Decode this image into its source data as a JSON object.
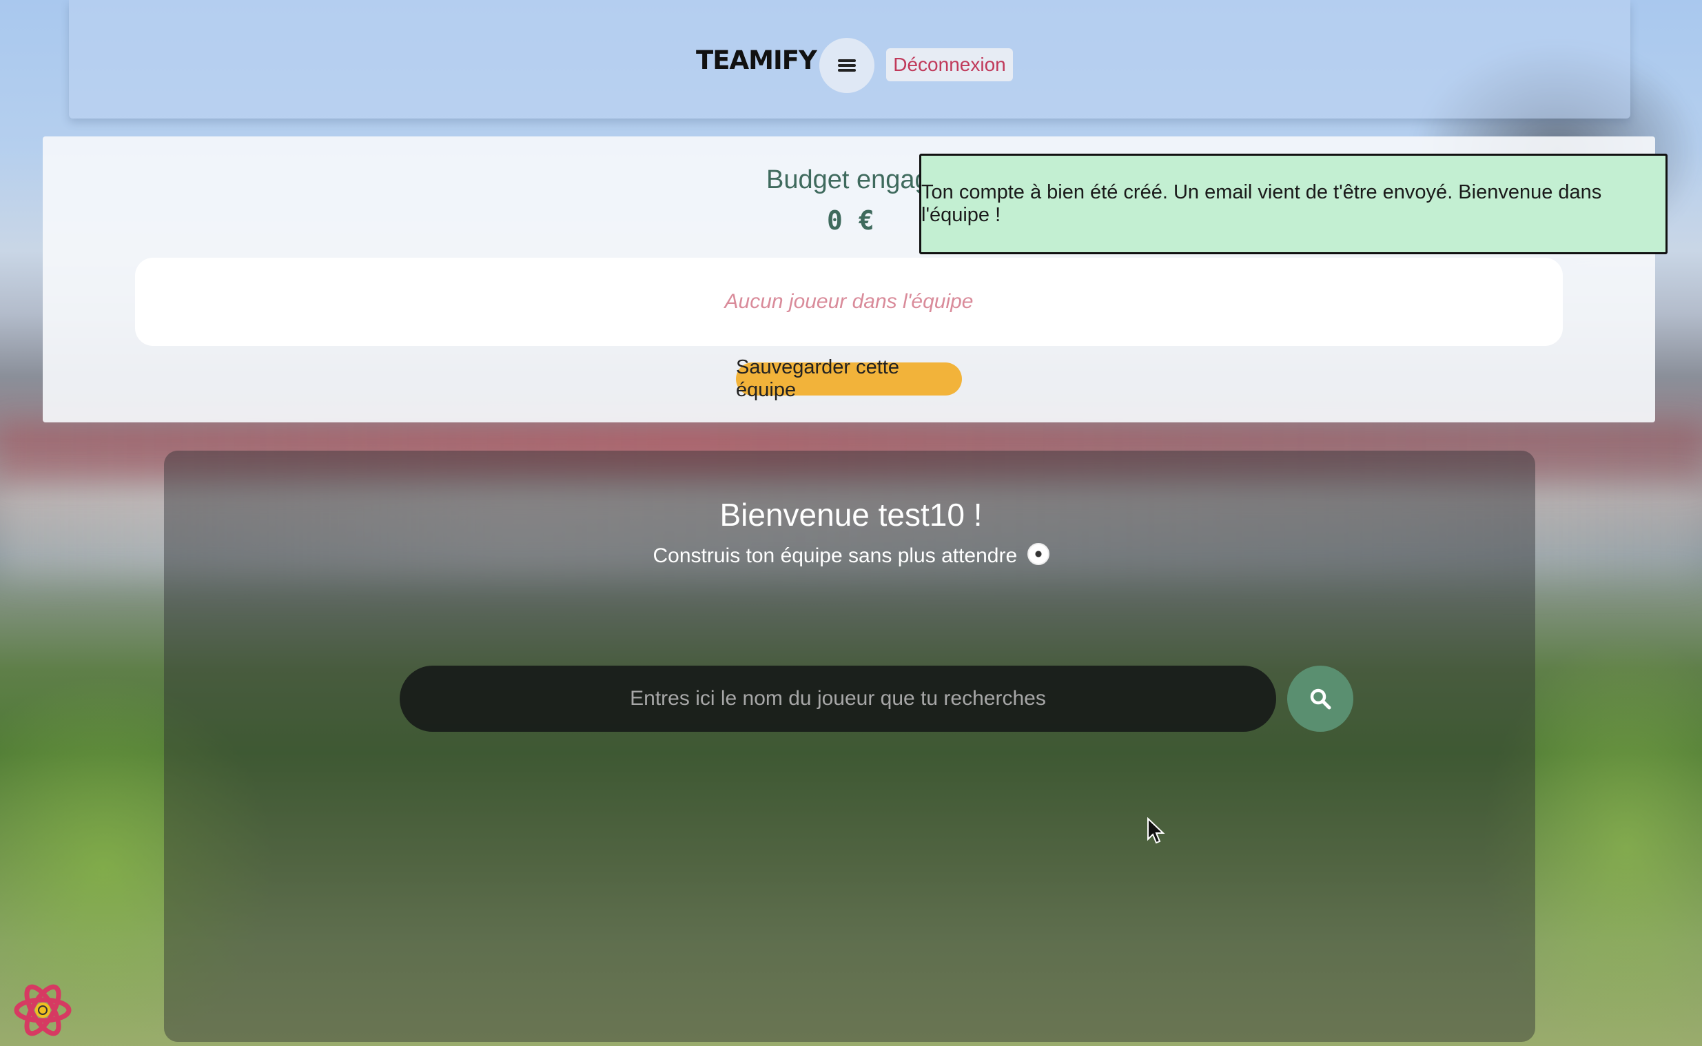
{
  "navbar": {
    "brand": "TEAMIFY",
    "menu_icon": "hamburger-menu-icon",
    "logout_label": "Déconnexion"
  },
  "team": {
    "budget_label": "Budget engagé",
    "budget_value": "0 €",
    "empty_message": "Aucun joueur dans l'équipe",
    "save_label": "Sauvegarder cette équipe"
  },
  "toast": {
    "message": "Ton compte à bien été créé. Un email vient de t'être envoyé. Bienvenue dans l'équipe !"
  },
  "welcome": {
    "title": "Bienvenue test10 !",
    "subtitle": "Construis ton équipe sans plus attendre",
    "subtitle_icon": "soccer-ball-icon"
  },
  "search": {
    "placeholder": "Entres ici le nom du joueur que tu recherches",
    "value": "",
    "button_icon": "search-icon"
  },
  "colors": {
    "accent_green": "#5a8f70",
    "save_yellow": "#f2b33a",
    "logout_red": "#c0395a",
    "toast_bg": "#c3efd2",
    "budget_text": "#3f6a5d"
  }
}
